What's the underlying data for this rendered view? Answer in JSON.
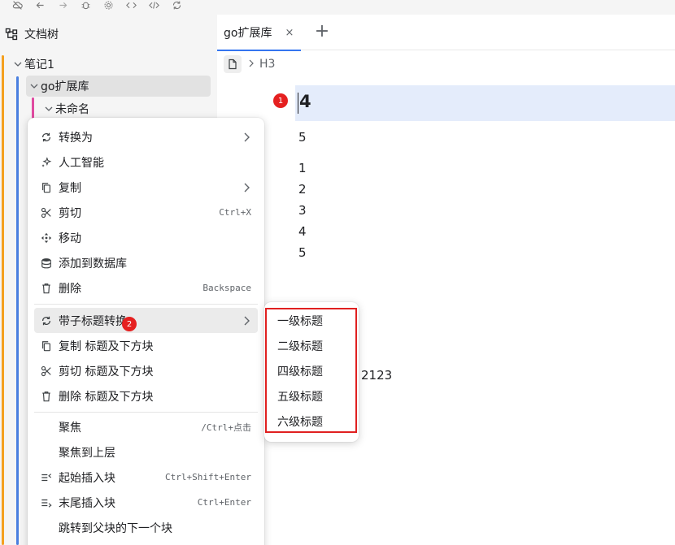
{
  "toolbar": {
    "icons": [
      "cloud-icon",
      "back-icon",
      "forward-icon",
      "bug-icon",
      "settings-icon",
      "code-icon",
      "code-alt-icon",
      "sync-icon"
    ]
  },
  "sidebar": {
    "title": "文档树",
    "items": [
      {
        "label": "笔记1"
      },
      {
        "label": "go扩展库"
      },
      {
        "label": "未命名"
      }
    ]
  },
  "tabs": [
    {
      "label": "go扩展库",
      "close": "×"
    }
  ],
  "tab_add": "+",
  "breadcrumb": {
    "heading": "H3"
  },
  "editor": {
    "heading": "4",
    "line_after_heading": "5",
    "list": [
      "1",
      "2",
      "3",
      "4",
      "5"
    ],
    "extra_text": "2123"
  },
  "badges": {
    "first": "1",
    "second": "2"
  },
  "context_menu": {
    "items": [
      {
        "label": "转换为",
        "shortcut": "",
        "submenu": true
      },
      {
        "label": "人工智能",
        "shortcut": "",
        "submenu": false
      },
      {
        "label": "复制",
        "shortcut": "",
        "submenu": true
      },
      {
        "label": "剪切",
        "shortcut": "Ctrl+X",
        "submenu": false
      },
      {
        "label": "移动",
        "shortcut": "",
        "submenu": false
      },
      {
        "label": "添加到数据库",
        "shortcut": "",
        "submenu": false
      },
      {
        "label": "删除",
        "shortcut": "Backspace",
        "submenu": false
      },
      {
        "label": "带子标题转换",
        "shortcut": "",
        "submenu": true
      },
      {
        "label": "复制 标题及下方块",
        "shortcut": "",
        "submenu": false
      },
      {
        "label": "剪切 标题及下方块",
        "shortcut": "",
        "submenu": false
      },
      {
        "label": "删除 标题及下方块",
        "shortcut": "",
        "submenu": false
      },
      {
        "label": "聚焦",
        "shortcut": "/Ctrl+点击",
        "submenu": false
      },
      {
        "label": "聚焦到上层",
        "shortcut": "",
        "submenu": false
      },
      {
        "label": "起始插入块",
        "shortcut": "Ctrl+Shift+Enter",
        "submenu": false
      },
      {
        "label": "末尾插入块",
        "shortcut": "Ctrl+Enter",
        "submenu": false
      },
      {
        "label": "跳转到父块的下一个块",
        "shortcut": "",
        "submenu": false
      }
    ]
  },
  "submenu": {
    "items": [
      "一级标题",
      "二级标题",
      "四级标题",
      "五级标题",
      "六级标题"
    ]
  },
  "colors": {
    "accent": "#3575f0",
    "highlight": "#e4ecfb",
    "badge": "#e52020",
    "outline": "#e02020",
    "guide_orange": "#f4a020",
    "guide_blue": "#4a7fe0",
    "guide_pink": "#e04aa0"
  }
}
